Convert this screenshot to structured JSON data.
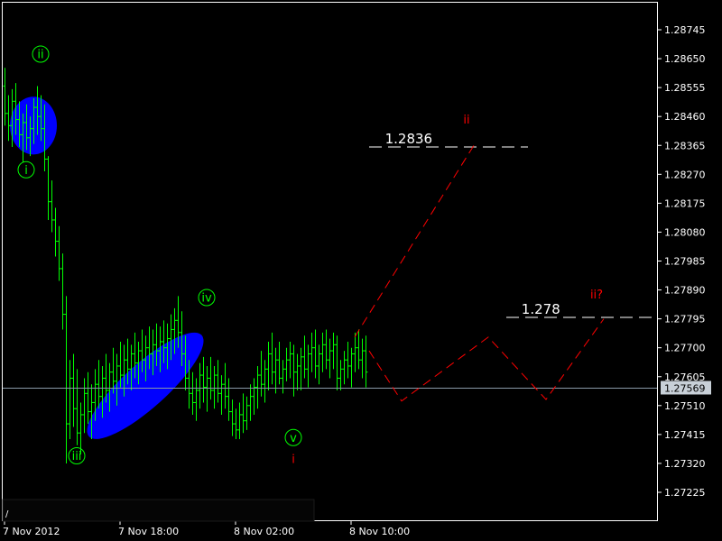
{
  "chart_data": {
    "type": "candlestick",
    "title": "",
    "xlabel": "",
    "ylabel": "",
    "ylim": [
      1.2717,
      1.2884
    ],
    "grid": false,
    "colors": {
      "background": "#000000",
      "frame": "#ffffff",
      "bars": "#00ff00",
      "wave_labels": "#00ff00",
      "forecast": "#ff0000",
      "highlight": "#0000ff",
      "level_lines": "#ffffff",
      "bid_line": "#8a9aa8"
    },
    "y_ticks": [
      "1.28745",
      "1.28650",
      "1.28555",
      "1.28460",
      "1.28365",
      "1.28270",
      "1.28175",
      "1.28080",
      "1.27985",
      "1.27890",
      "1.27795",
      "1.27700",
      "1.27605",
      "1.27510",
      "1.27415",
      "1.27320",
      "1.27225"
    ],
    "x_ticks": [
      {
        "label": "7 Nov 2012",
        "bar": 0
      },
      {
        "label": "7 Nov 18:00",
        "bar": 32
      },
      {
        "label": "8 Nov 02:00",
        "bar": 64
      },
      {
        "label": "8 Nov 10:00",
        "bar": 96
      }
    ],
    "current_price": "1.27569",
    "ohlc": [
      [
        1.2856,
        1.2862,
        1.2843,
        1.2847
      ],
      [
        1.2847,
        1.2853,
        1.2838,
        1.2843
      ],
      [
        1.2843,
        1.2855,
        1.2836,
        1.2851
      ],
      [
        1.2851,
        1.2857,
        1.284,
        1.2845
      ],
      [
        1.2845,
        1.2851,
        1.2836,
        1.284
      ],
      [
        1.284,
        1.2847,
        1.2831,
        1.2844
      ],
      [
        1.2844,
        1.285,
        1.2835,
        1.2839
      ],
      [
        1.2839,
        1.2846,
        1.2833,
        1.2842
      ],
      [
        1.2842,
        1.2852,
        1.2837,
        1.2849
      ],
      [
        1.2849,
        1.2856,
        1.284,
        1.2846
      ],
      [
        1.2846,
        1.2853,
        1.2838,
        1.2842
      ],
      [
        1.2842,
        1.285,
        1.2828,
        1.2832
      ],
      [
        1.2832,
        1.2833,
        1.2812,
        1.2818
      ],
      [
        1.2818,
        1.2825,
        1.2808,
        1.2812
      ],
      [
        1.2812,
        1.2816,
        1.28,
        1.2805
      ],
      [
        1.2805,
        1.281,
        1.2792,
        1.2796
      ],
      [
        1.2796,
        1.2801,
        1.2776,
        1.2781
      ],
      [
        1.2781,
        1.2787,
        1.2732,
        1.2745
      ],
      [
        1.2745,
        1.2766,
        1.274,
        1.276
      ],
      [
        1.276,
        1.2768,
        1.2744,
        1.275
      ],
      [
        1.275,
        1.2763,
        1.2738,
        1.2742
      ],
      [
        1.2742,
        1.2752,
        1.2735,
        1.2748
      ],
      [
        1.2748,
        1.276,
        1.2742,
        1.2755
      ],
      [
        1.2755,
        1.2762,
        1.2745,
        1.2749
      ],
      [
        1.2749,
        1.2758,
        1.274,
        1.2752
      ],
      [
        1.2752,
        1.2763,
        1.2746,
        1.2758
      ],
      [
        1.2758,
        1.2766,
        1.275,
        1.2754
      ],
      [
        1.2754,
        1.2764,
        1.2747,
        1.276
      ],
      [
        1.276,
        1.2768,
        1.2752,
        1.2756
      ],
      [
        1.2756,
        1.2765,
        1.2749,
        1.2762
      ],
      [
        1.2762,
        1.277,
        1.2755,
        1.2759
      ],
      [
        1.2759,
        1.2768,
        1.2751,
        1.2764
      ],
      [
        1.2764,
        1.2772,
        1.2757,
        1.2761
      ],
      [
        1.2761,
        1.2771,
        1.2754,
        1.2766
      ],
      [
        1.2766,
        1.2773,
        1.2758,
        1.2763
      ],
      [
        1.2763,
        1.2771,
        1.2756,
        1.2768
      ],
      [
        1.2768,
        1.2775,
        1.276,
        1.2765
      ],
      [
        1.2765,
        1.2772,
        1.2758,
        1.2769
      ],
      [
        1.2769,
        1.2776,
        1.2762,
        1.2766
      ],
      [
        1.2766,
        1.2774,
        1.2759,
        1.277
      ],
      [
        1.277,
        1.2777,
        1.2763,
        1.2768
      ],
      [
        1.2768,
        1.2776,
        1.2761,
        1.2771
      ],
      [
        1.2771,
        1.2778,
        1.2764,
        1.2769
      ],
      [
        1.2769,
        1.2777,
        1.2762,
        1.2772
      ],
      [
        1.2772,
        1.2779,
        1.2765,
        1.277
      ],
      [
        1.277,
        1.2778,
        1.2763,
        1.2773
      ],
      [
        1.2773,
        1.2781,
        1.2766,
        1.2776
      ],
      [
        1.2776,
        1.2783,
        1.2768,
        1.2779
      ],
      [
        1.2779,
        1.2787,
        1.277,
        1.2775
      ],
      [
        1.2775,
        1.2782,
        1.2764,
        1.2768
      ],
      [
        1.2768,
        1.2774,
        1.2756,
        1.276
      ],
      [
        1.276,
        1.2766,
        1.275,
        1.2755
      ],
      [
        1.2755,
        1.2762,
        1.2748,
        1.2752
      ],
      [
        1.2752,
        1.276,
        1.2746,
        1.2756
      ],
      [
        1.2756,
        1.2765,
        1.275,
        1.2761
      ],
      [
        1.2761,
        1.2767,
        1.2752,
        1.2757
      ],
      [
        1.2757,
        1.2764,
        1.2749,
        1.276
      ],
      [
        1.276,
        1.2767,
        1.2753,
        1.2756
      ],
      [
        1.2756,
        1.2764,
        1.275,
        1.2761
      ],
      [
        1.2761,
        1.2766,
        1.2752,
        1.2755
      ],
      [
        1.2755,
        1.2761,
        1.2748,
        1.2758
      ],
      [
        1.2758,
        1.2765,
        1.275,
        1.2754
      ],
      [
        1.2754,
        1.276,
        1.2746,
        1.2749
      ],
      [
        1.2749,
        1.2753,
        1.2741,
        1.2745
      ],
      [
        1.2745,
        1.275,
        1.274,
        1.2743
      ],
      [
        1.2743,
        1.2752,
        1.274,
        1.2748
      ],
      [
        1.2748,
        1.2755,
        1.2742,
        1.2746
      ],
      [
        1.2746,
        1.2754,
        1.2743,
        1.2751
      ],
      [
        1.2751,
        1.2758,
        1.2746,
        1.2754
      ],
      [
        1.2754,
        1.276,
        1.2748,
        1.2757
      ],
      [
        1.2757,
        1.2764,
        1.275,
        1.2761
      ],
      [
        1.2761,
        1.2769,
        1.2754,
        1.2758
      ],
      [
        1.2758,
        1.2766,
        1.2752,
        1.2763
      ],
      [
        1.2763,
        1.2772,
        1.2756,
        1.2768
      ],
      [
        1.2768,
        1.2775,
        1.2758,
        1.2762
      ],
      [
        1.2762,
        1.277,
        1.2755,
        1.2766
      ],
      [
        1.2766,
        1.2772,
        1.2758,
        1.276
      ],
      [
        1.276,
        1.2766,
        1.2755,
        1.2763
      ],
      [
        1.2763,
        1.277,
        1.2759,
        1.2766
      ],
      [
        1.2766,
        1.2772,
        1.276,
        1.2768
      ],
      [
        1.2768,
        1.2771,
        1.2754,
        1.2762
      ],
      [
        1.2762,
        1.2768,
        1.2756,
        1.2764
      ],
      [
        1.2764,
        1.277,
        1.2756,
        1.2767
      ],
      [
        1.2767,
        1.2774,
        1.276,
        1.2763
      ],
      [
        1.2763,
        1.2771,
        1.2757,
        1.2768
      ],
      [
        1.2768,
        1.2775,
        1.2762,
        1.277
      ],
      [
        1.277,
        1.2776,
        1.276,
        1.2764
      ],
      [
        1.2764,
        1.2771,
        1.2758,
        1.2768
      ],
      [
        1.2768,
        1.2775,
        1.2762,
        1.2771
      ],
      [
        1.2771,
        1.2776,
        1.2763,
        1.2766
      ],
      [
        1.2766,
        1.2773,
        1.276,
        1.2769
      ],
      [
        1.2769,
        1.2775,
        1.2763,
        1.2771
      ],
      [
        1.2771,
        1.2774,
        1.2756,
        1.276
      ],
      [
        1.276,
        1.2766,
        1.2756,
        1.2763
      ],
      [
        1.2763,
        1.2769,
        1.2758,
        1.2766
      ],
      [
        1.2766,
        1.2772,
        1.276,
        1.2764
      ],
      [
        1.2764,
        1.277,
        1.2757,
        1.2768
      ],
      [
        1.2768,
        1.2775,
        1.2762,
        1.277
      ],
      [
        1.277,
        1.2776,
        1.2763,
        1.2766
      ],
      [
        1.2766,
        1.2773,
        1.276,
        1.2769
      ],
      [
        1.2769,
        1.2774,
        1.2757,
        1.2762
      ]
    ],
    "wave_labels": [
      {
        "text": "ii",
        "bar": 10,
        "price": 1.28665,
        "color": "#00ff00",
        "circled": true
      },
      {
        "text": "i",
        "bar": 6,
        "price": 1.28285,
        "color": "#00ff00",
        "circled": true
      },
      {
        "text": "iii",
        "bar": 20,
        "price": 1.27345,
        "color": "#00ff00",
        "circled": true
      },
      {
        "text": "iv",
        "bar": 56,
        "price": 1.27865,
        "color": "#00ff00",
        "circled": true
      },
      {
        "text": "v",
        "bar": 80,
        "price": 1.27405,
        "color": "#00ff00",
        "circled": true
      },
      {
        "text": "i",
        "bar": 80,
        "price": 1.27335,
        "color": "#ff0000",
        "circled": false
      },
      {
        "text": "ii",
        "bar": 128,
        "price": 1.2845,
        "color": "#ff0000",
        "circled": false
      },
      {
        "text": "ii?",
        "bar": 164,
        "price": 1.27875,
        "color": "#ff0000",
        "circled": false
      }
    ],
    "level_lines": [
      {
        "label": "1.2836",
        "price": 1.2836,
        "bar_start": 101,
        "bar_end": 145
      },
      {
        "label": "1.278",
        "price": 1.278,
        "bar_start": 139,
        "bar_end": 181
      }
    ],
    "forecast_paths": [
      {
        "name": "",
        "points": [
          [
            97,
            1.27735
          ],
          [
            130,
            1.28365
          ]
        ]
      },
      {
        "name": "",
        "points": [
          [
            101,
            1.2769
          ],
          [
            110,
            1.27525
          ],
          [
            134,
            1.27735
          ],
          [
            150,
            1.2753
          ],
          [
            166,
            1.27795
          ]
        ]
      }
    ],
    "highlight_ellipses": [
      {
        "bar_center": 8,
        "price_center": 1.2843,
        "bar_rx": 6.5,
        "price_ry": 0.00095,
        "rotation_deg": 0
      },
      {
        "bar_center": 39,
        "price_center": 1.27575,
        "bar_rx": 21,
        "price_ry": 0.00072,
        "rotation_deg": -42
      }
    ],
    "bid_line": 1.27569
  }
}
